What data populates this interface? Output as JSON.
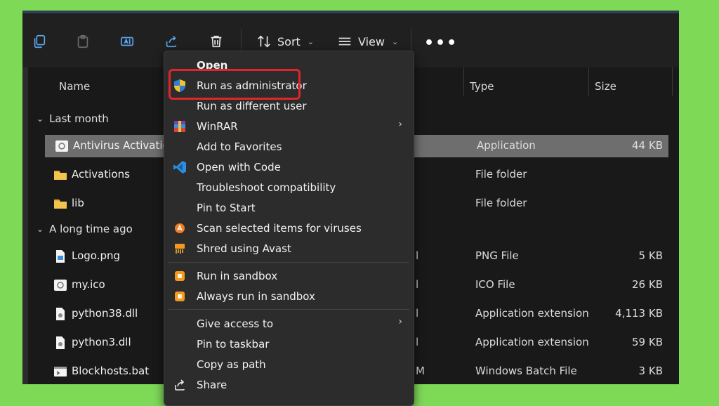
{
  "toolbar": {
    "sort_label": "Sort",
    "view_label": "View",
    "more_label": "•••"
  },
  "columns": {
    "name": "Name",
    "type": "Type",
    "size": "Size"
  },
  "groups": {
    "last_month": "Last month",
    "long_ago": "A long time ago"
  },
  "files": [
    {
      "name": "Antivirus Activation",
      "type": "Application",
      "size": "44 KB",
      "icon": "app-icon"
    },
    {
      "name": "Activations",
      "type": "File folder",
      "size": "",
      "icon": "folder-icon"
    },
    {
      "name": "lib",
      "type": "File folder",
      "size": "",
      "icon": "folder-icon"
    },
    {
      "name": "Logo.png",
      "type": "PNG File",
      "size": "5 KB",
      "icon": "image-file-icon"
    },
    {
      "name": "my.ico",
      "type": "ICO File",
      "size": "26 KB",
      "icon": "ico-file-icon"
    },
    {
      "name": "python38.dll",
      "type": "Application extension",
      "size": "4,113 KB",
      "icon": "dll-file-icon"
    },
    {
      "name": "python3.dll",
      "type": "Application extension",
      "size": "59 KB",
      "icon": "dll-file-icon"
    },
    {
      "name": "Blockhosts.bat",
      "type": "Windows Batch File",
      "size": "3 KB",
      "icon": "bat-file-icon"
    }
  ],
  "partial_dates": [
    "l",
    "l",
    "l",
    "l",
    "M"
  ],
  "menu": {
    "open": "Open",
    "run_admin": "Run as administrator",
    "run_different": "Run as different user",
    "winrar": "WinRAR",
    "add_favorites": "Add to Favorites",
    "open_code": "Open with Code",
    "troubleshoot": "Troubleshoot compatibility",
    "pin_start": "Pin to Start",
    "scan": "Scan selected items for viruses",
    "shred": "Shred using Avast",
    "run_sandbox": "Run in sandbox",
    "always_sandbox": "Always run in sandbox",
    "give_access": "Give access to",
    "pin_taskbar": "Pin to taskbar",
    "copy_path": "Copy as path",
    "share": "Share",
    "submenu_arrow": "›"
  },
  "colors": {
    "background": "#7ed957",
    "highlight": "#e0262b",
    "selection": "#6e6e6e"
  }
}
